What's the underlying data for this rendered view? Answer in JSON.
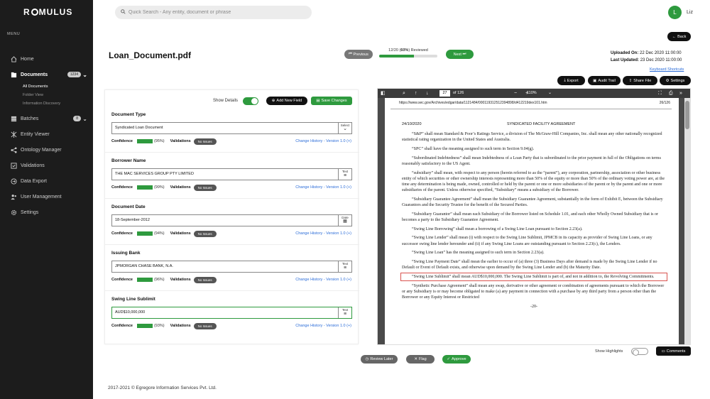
{
  "app": {
    "logo_text": [
      "R",
      "MULUS"
    ]
  },
  "sidebar": {
    "menu_label": "MENU",
    "items": [
      {
        "label": "Home",
        "icon": "home-icon"
      },
      {
        "label": "Documents",
        "icon": "documents-icon",
        "badge": "1234"
      },
      {
        "label": "Batches",
        "icon": "batches-icon",
        "badge": "8"
      },
      {
        "label": "Entity Viewer",
        "icon": "entity-icon"
      },
      {
        "label": "Ontology Manager",
        "icon": "ontology-icon"
      },
      {
        "label": "Validations",
        "icon": "validations-icon"
      },
      {
        "label": "Data Export",
        "icon": "export-icon"
      },
      {
        "label": "User Management",
        "icon": "users-icon"
      },
      {
        "label": "Settings",
        "icon": "gear-icon"
      }
    ],
    "documents_sub": [
      "All Documents",
      "Folder View",
      "Information Discovery"
    ]
  },
  "header": {
    "search_placeholder": "Quick Search - Any entity, document or phrase",
    "avatar_initial": "L",
    "user_name": "Liz"
  },
  "main": {
    "back_label": "Back",
    "doc_title": "Loan_Document.pdf",
    "prev_label": "Previous",
    "next_label": "Next",
    "progress": {
      "text_pre": "12/20 (",
      "percent_text": "60%",
      "text_post": ") Reviewed",
      "fraction": 0.6
    },
    "uploaded_label": "Uploaded On:",
    "uploaded_value": "22 Dec 2020 11:00:00",
    "updated_label": "Last Updated:",
    "updated_value": "23 Dec 2020 11:00:00",
    "keyboard_shortcuts": "Keyboard Shortcuts",
    "tools": {
      "export": "Export",
      "audit": "Audit Trail",
      "share": "Share File",
      "settings": "Settings"
    }
  },
  "form": {
    "show_details": "Show Details",
    "add_field": "Add New Field",
    "save_changes": "Save Changes",
    "confidence_label": "Confidence",
    "validations_label": "Validations",
    "no_issues": "No Issues",
    "fields": [
      {
        "label": "Document Type",
        "value": "Syndicated Loan Document",
        "type": "Select",
        "confidence": "(95%)",
        "change": "Change History - Version 1.0 (+)"
      },
      {
        "label": "Borrower Name",
        "value": "THE MAC SERVICES GROUP PTY LIMITED",
        "type": "Text",
        "confidence": "(99%)",
        "change": "Change History - Version 1.0 (+)"
      },
      {
        "label": "Document Date",
        "value": "18-September-2012",
        "type": "Date",
        "confidence": "(94%)",
        "change": "Change History - Version 1.0 (+)"
      },
      {
        "label": "Issuing Bank",
        "value": "JPMORGAN CHASE BANK, N.A.",
        "type": "Text",
        "confidence": "(96%)",
        "change": "Change History - Version 1.0 (+)"
      },
      {
        "label": "Swing Line Sublimit",
        "value": "AUD$10,000,000",
        "type": "Text",
        "confidence": "(93%)",
        "change": "Change History - Version 1.0 (+)"
      }
    ]
  },
  "pdf": {
    "page_current": "27",
    "page_total": "of 126",
    "zoom": "110%",
    "url": "https://www.sec.gov/Archives/edgar/data/1121484/000119312512394898/d412219dex101.htm",
    "page_num": "26/126",
    "date": "24/10/2020",
    "heading": "SYNDICATED FACILITY AGREEMENT",
    "paragraphs": [
      "“S&P” shall mean Standard & Poor’s Ratings Service, a division of The McGraw-Hill Companies, Inc. shall mean any other nationally recognized statistical rating organization in the United States and Australia.",
      "“SPC” shall have the meaning assigned to such term in Section 9.04(g).",
      "“Subordinated Indebtedness” shall mean Indebtedness of a Loan Party that is subordinated to the prior payment in full of the Obligations on terms reasonably satisfactory to the US Agent.",
      "“subsidiary” shall mean, with respect to any person (herein referred to as the “parent”), any corporation, partnership, association or other business entity of which securities or other ownership interests representing more than 50% of the equity or more than 50% of the ordinary voting power are, at the time any determination is being made, owned, controlled or held by the parent or one or more subsidiaries of the parent or by the parent and one or more subsidiaries of the parent. Unless otherwise specified, “Subsidiary” means a subsidiary of the Borrower.",
      "“Subsidiary Guarantee Agreement” shall mean the Subsidiary Guarantee Agreement, substantially in the form of Exhibit E, between the Subsidiary Guarantors and the Security Trustee for the benefit of the Secured Parties.",
      "“Subsidiary Guarantor” shall mean each Subsidiary of the Borrower listed on Schedule 1.01, and each other Wholly Owned Subsidiary that is or becomes a party to the Subsidiary Guarantee Agreement.",
      "“Swing Line Borrowing” shall mean a borrowing of a Swing Line Loan pursuant to Section 2.23(a).",
      "“Swing Line Lender” shall mean (i) with respect to the Swing Line Sublimit, JPMCB in its capacity as provider of Swing Line Loans, or any successor swing line lender hereunder and (ii) if any Swing Line Loans are outstanding pursuant to Section 2.23(c), the Lenders.",
      "“Swing Line Loan” has the meaning assigned to such term in Section 2.23(a).",
      "“Swing Line Payment Date” shall mean the earlier to occur of (a) three (3) Business Days after demand is made by the Swing Line Lender if no Default or Event of Default exists, and otherwise upon demand by the Swing Line Lender and (b) the Maturity Date.",
      "“Swing Line Sublimit” shall mean AUD$10,000,000. The Swing Line Sublimit is part of, and not in addition to, the Revolving Commitments.",
      "“Synthetic Purchase Agreement” shall mean any swap, derivative or other agreement or combination of agreements pursuant to which the Borrower or any Subsidiary is or may become obligated to make (a) any payment in connection with a purchase by any third party from a person other than the Borrower or any Equity Interest or Restricted"
    ],
    "footer": "-20-"
  },
  "bottom": {
    "show_highlights": "Show Highlights",
    "comments": "Comments",
    "review_later": "Review Later",
    "flag": "Flag",
    "approve": "Approve"
  },
  "footer": {
    "text": "2017-2021 © Egregore Information Services Pvt. Ltd."
  },
  "colors": {
    "accent": "#2e9a3e",
    "dark": "#111111",
    "sidebar": "#1c1c1c",
    "link": "#2b6cd8"
  }
}
